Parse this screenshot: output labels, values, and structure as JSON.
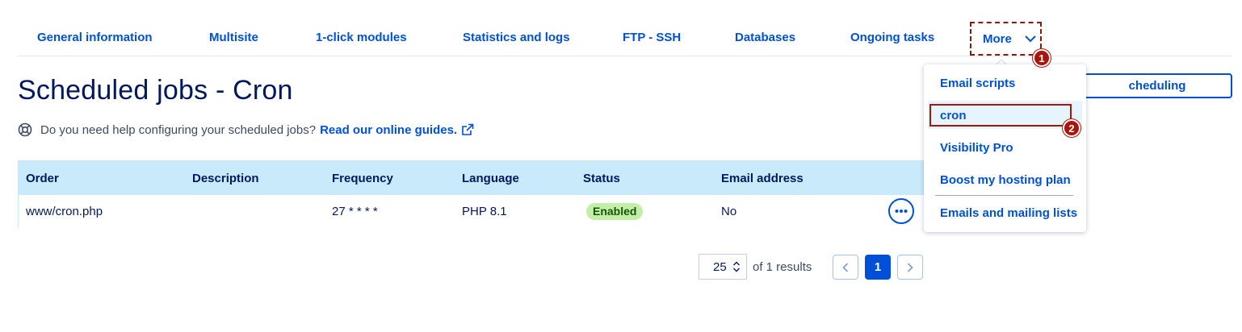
{
  "tabs": [
    {
      "label": "General information"
    },
    {
      "label": "Multisite"
    },
    {
      "label": "1-click modules"
    },
    {
      "label": "Statistics and logs"
    },
    {
      "label": "FTP - SSH"
    },
    {
      "label": "Databases"
    },
    {
      "label": "Ongoing tasks"
    }
  ],
  "more_tab": {
    "label": "More",
    "icon": "chevron-down-icon"
  },
  "annotations": {
    "badge_1": "1",
    "badge_2": "2"
  },
  "page_title": "Scheduled jobs - Cron",
  "help": {
    "text": "Do you need help configuring your scheduled jobs?",
    "link": "Read our online guides.",
    "icon": "lifebuoy-icon",
    "link_icon": "external-link-icon"
  },
  "schedule_button": {
    "label": "cheduling"
  },
  "table": {
    "headers": [
      "Order",
      "Description",
      "Frequency",
      "Language",
      "Status",
      "Email address"
    ],
    "rows": [
      {
        "order": "www/cron.php",
        "description": "",
        "frequency": "27 * * * *",
        "language": "PHP 8.1",
        "status": "Enabled",
        "email": "No"
      }
    ]
  },
  "pagination": {
    "page_size": "25",
    "results_text": "of 1 results",
    "current_page": "1"
  },
  "dropdown": {
    "items": [
      "Email scripts",
      "cron",
      "Visibility Pro",
      "Boost my hosting plan",
      "Emails and mailing lists"
    ]
  },
  "colors": {
    "accent": "#0050d7",
    "header_bg": "#c9eafb",
    "status_enabled": "#c3eeaa",
    "annotation": "#a8150b"
  }
}
